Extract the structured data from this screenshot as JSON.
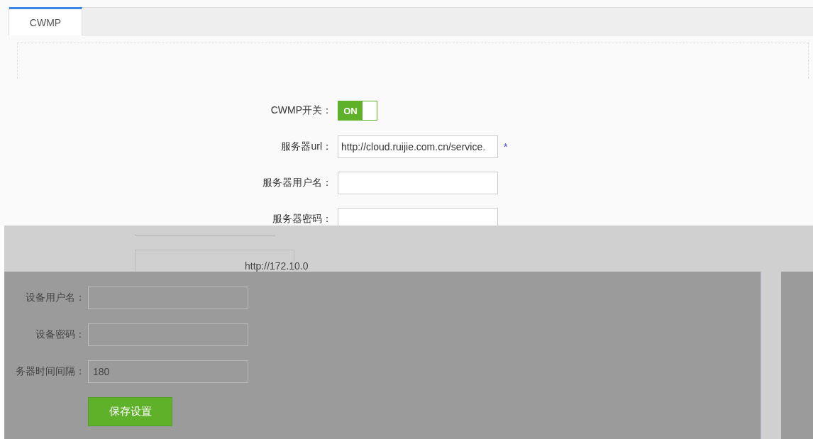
{
  "tabs": [
    {
      "label": "CWMP",
      "selected": true
    }
  ],
  "form": [
    {
      "kind": "switch",
      "label": "CWMP开关：",
      "on": true,
      "text": "ON"
    },
    {
      "kind": "field",
      "label": "服务器url：",
      "value": "http://cloud.ruijie.com.cn/service.",
      "required": "*"
    },
    {
      "kind": "field",
      "label": "服务器用户名："
    },
    {
      "kind": "field",
      "label": "服务器密码："
    }
  ],
  "band": {
    "value": "http://172.10.0"
  },
  "device_form": [
    {
      "label": "设备用户名："
    },
    {
      "label": "设备密码："
    },
    {
      "label": "务器时间间隔：",
      "value": "180"
    }
  ],
  "save_button": "保存设置"
}
